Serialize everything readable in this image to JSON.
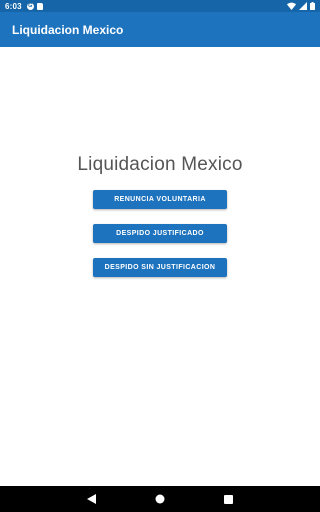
{
  "status_bar": {
    "time": "6:03",
    "icons": [
      "google-notification-icon",
      "sd-card-icon",
      "wifi-icon",
      "signal-icon",
      "battery-icon"
    ]
  },
  "app_bar": {
    "title": "Liquidacion Mexico"
  },
  "main": {
    "heading": "Liquidacion Mexico",
    "buttons": [
      {
        "label": "RENUNCIA VOLUNTARIA"
      },
      {
        "label": "DESPIDO JUSTIFICADO"
      },
      {
        "label": "DESPIDO SIN JUSTIFICACION"
      }
    ]
  },
  "nav_bar": {
    "icons": [
      "back-icon",
      "home-icon",
      "recents-icon"
    ]
  },
  "colors": {
    "status_bar": "#1565a8",
    "app_bar": "#1e73be",
    "button": "#1e73be",
    "heading_text": "#555555",
    "nav_bar": "#000000"
  }
}
